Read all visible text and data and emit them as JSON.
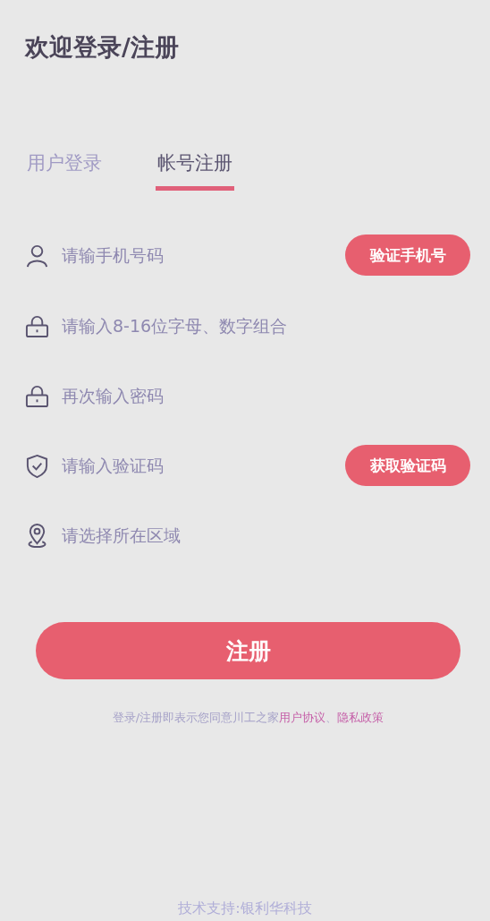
{
  "title": "欢迎登录/注册",
  "tabs": [
    {
      "label": "用户登录",
      "selected": false
    },
    {
      "label": "帐号注册",
      "selected": true
    }
  ],
  "fields": [
    {
      "kind": "user",
      "placeholder": "请输手机号码",
      "action": "验证手机号"
    },
    {
      "kind": "lock",
      "placeholder": "请输入8-16位字母、数字组合"
    },
    {
      "kind": "lock",
      "placeholder": "再次输入密码"
    },
    {
      "kind": "shield",
      "placeholder": "请输入验证码",
      "action": "获取验证码"
    },
    {
      "kind": "pin",
      "placeholder": "请选择所在区域"
    }
  ],
  "submit": "注册",
  "agreement": {
    "text": "登录/注册即表示您同意川工之家",
    "links": [
      "用户协议",
      "隐私政策"
    ],
    "separator": "、"
  },
  "footer": "技术支持:银利华科技"
}
